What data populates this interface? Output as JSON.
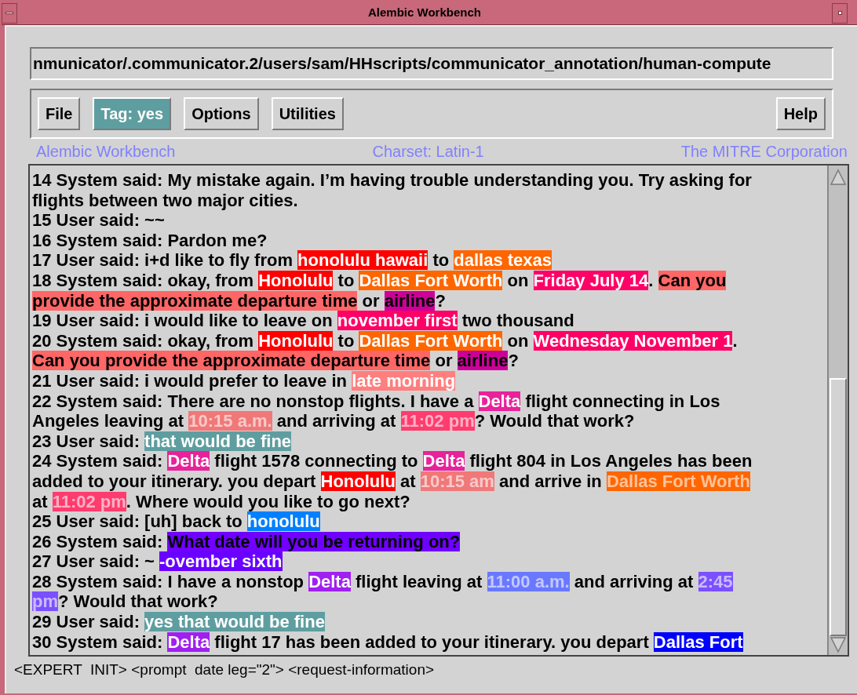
{
  "window": {
    "title": "Alembic Workbench"
  },
  "path_field": {
    "value": "nmunicator/.communicator.2/users/sam/HHscripts/communicator_annotation/human-compute"
  },
  "menu_buttons": [
    {
      "label": "File",
      "selected": false
    },
    {
      "label": "Tag: yes",
      "selected": true
    },
    {
      "label": "Options",
      "selected": false
    },
    {
      "label": "Utilities",
      "selected": false
    }
  ],
  "help_button": {
    "label": "Help"
  },
  "info_bar": {
    "left": "Alembic Workbench",
    "center": "Charset: Latin-1",
    "right": "The MITRE Corporation"
  },
  "transcript": [
    {
      "segments": [
        {
          "kind": "plain",
          "text": "14 System said: My mistake again. I’m having trouble understanding you. Try asking for"
        }
      ]
    },
    {
      "segments": [
        {
          "kind": "plain",
          "text": "flights between two major cities."
        }
      ]
    },
    {
      "segments": [
        {
          "kind": "plain",
          "text": "15 User said: ~~"
        }
      ]
    },
    {
      "segments": [
        {
          "kind": "plain",
          "text": "16 System said: Pardon me?"
        }
      ]
    },
    {
      "segments": [
        {
          "kind": "plain",
          "text": "17 User said: i+d like to fly from "
        },
        {
          "kind": "tag",
          "text": "honolulu hawaii",
          "color": "#ff0000"
        },
        {
          "kind": "plain",
          "text": " to "
        },
        {
          "kind": "tag",
          "text": "dallas texas",
          "color": "#ff6600"
        }
      ]
    },
    {
      "segments": [
        {
          "kind": "plain",
          "text": "18 System said: okay, from "
        },
        {
          "kind": "tag",
          "text": "Honolulu",
          "color": "#ff0000"
        },
        {
          "kind": "plain",
          "text": " to "
        },
        {
          "kind": "tag",
          "text": "Dallas Fort Worth",
          "color": "#ff6600"
        },
        {
          "kind": "plain",
          "text": " on "
        },
        {
          "kind": "tag",
          "text": "Friday July 14",
          "color": "#ff0066"
        },
        {
          "kind": "plain",
          "text": ". "
        },
        {
          "kind": "tag_dark",
          "text": "Can you",
          "color": "#ff6666"
        }
      ]
    },
    {
      "segments": [
        {
          "kind": "tag_dark",
          "text": "provide the approximate departure time",
          "color": "#ff6666"
        },
        {
          "kind": "plain",
          "text": " or "
        },
        {
          "kind": "tag_dark",
          "text": "airline",
          "color": "#cc0099"
        },
        {
          "kind": "plain",
          "text": "?"
        }
      ]
    },
    {
      "segments": [
        {
          "kind": "plain",
          "text": "19 User said: i would like to leave on "
        },
        {
          "kind": "tag",
          "text": "november first",
          "color": "#ff0066"
        },
        {
          "kind": "plain",
          "text": " two thousand"
        }
      ]
    },
    {
      "segments": [
        {
          "kind": "plain",
          "text": "20 System said: okay, from "
        },
        {
          "kind": "tag",
          "text": "Honolulu",
          "color": "#ff0000"
        },
        {
          "kind": "plain",
          "text": " to "
        },
        {
          "kind": "tag",
          "text": "Dallas Fort Worth",
          "color": "#ff6600"
        },
        {
          "kind": "plain",
          "text": " on "
        },
        {
          "kind": "tag",
          "text": "Wednesday November 1",
          "color": "#ff0066"
        },
        {
          "kind": "plain",
          "text": "."
        }
      ]
    },
    {
      "segments": [
        {
          "kind": "tag_dark",
          "text": "Can you provide the approximate departure time",
          "color": "#ff6666"
        },
        {
          "kind": "plain",
          "text": " or "
        },
        {
          "kind": "tag_dark",
          "text": "airline",
          "color": "#cc0099"
        },
        {
          "kind": "plain",
          "text": "?"
        }
      ]
    },
    {
      "segments": [
        {
          "kind": "plain",
          "text": "21 User said: i would prefer to leave in "
        },
        {
          "kind": "tag",
          "text": "late morning",
          "color": "#ff7f7f"
        }
      ]
    },
    {
      "segments": [
        {
          "kind": "plain",
          "text": "22 System said: There are no nonstop flights. I have a "
        },
        {
          "kind": "tag",
          "text": "Delta",
          "color": "#e8229a"
        },
        {
          "kind": "plain",
          "text": " flight connecting in Los"
        }
      ]
    },
    {
      "segments": [
        {
          "kind": "plain",
          "text": "Angeles leaving at "
        },
        {
          "kind": "tag_faint",
          "text": "10:15 a.m.",
          "color": "#f07878"
        },
        {
          "kind": "plain",
          "text": " and arriving at "
        },
        {
          "kind": "tag_faint",
          "text": "11:02 pm",
          "color": "#ff3c6e"
        },
        {
          "kind": "plain",
          "text": "? Would that work?"
        }
      ]
    },
    {
      "segments": [
        {
          "kind": "plain",
          "text": "23 User said: "
        },
        {
          "kind": "tag",
          "text": "that would be fine",
          "color": "#5f9ea0"
        }
      ]
    },
    {
      "segments": [
        {
          "kind": "plain",
          "text": "24 System said: "
        },
        {
          "kind": "tag",
          "text": "Delta",
          "color": "#e8229a"
        },
        {
          "kind": "plain",
          "text": " flight 1578 connecting to "
        },
        {
          "kind": "tag",
          "text": "Delta",
          "color": "#e8229a"
        },
        {
          "kind": "plain",
          "text": " flight 804 in Los Angeles has been"
        }
      ]
    },
    {
      "segments": [
        {
          "kind": "plain",
          "text": "added to your itinerary. you depart "
        },
        {
          "kind": "tag",
          "text": "Honolulu",
          "color": "#ff0000"
        },
        {
          "kind": "plain",
          "text": " at "
        },
        {
          "kind": "tag_faint",
          "text": "10:15 am",
          "color": "#f07878"
        },
        {
          "kind": "plain",
          "text": " and arrive in "
        },
        {
          "kind": "tag_faint",
          "text": "Dallas Fort Worth",
          "color": "#ff6600"
        }
      ]
    },
    {
      "segments": [
        {
          "kind": "plain",
          "text": "at "
        },
        {
          "kind": "tag_faint",
          "text": "11:02 pm",
          "color": "#ff3c6e"
        },
        {
          "kind": "plain",
          "text": ". Where would you like to go next?"
        }
      ]
    },
    {
      "segments": [
        {
          "kind": "plain",
          "text": "25 User said: [uh] back to "
        },
        {
          "kind": "tag",
          "text": "honolulu",
          "color": "#0080ff"
        }
      ]
    },
    {
      "segments": [
        {
          "kind": "plain",
          "text": "26 System said: "
        },
        {
          "kind": "tag_dark",
          "text": "What date will you be returning on?",
          "color": "#7000ff"
        }
      ]
    },
    {
      "segments": [
        {
          "kind": "plain",
          "text": "27 User said: ~ "
        },
        {
          "kind": "tag",
          "text": "-ovember sixth",
          "color": "#6a00ff"
        }
      ]
    },
    {
      "segments": [
        {
          "kind": "plain",
          "text": "28 System said: I have a nonstop "
        },
        {
          "kind": "tag",
          "text": "Delta",
          "color": "#a020f0"
        },
        {
          "kind": "plain",
          "text": " flight leaving at "
        },
        {
          "kind": "tag_faint",
          "text": "11:00 a.m.",
          "color": "#6a78ff"
        },
        {
          "kind": "plain",
          "text": " and arriving at "
        },
        {
          "kind": "tag_faint",
          "text": "2:45",
          "color": "#7a50ff"
        }
      ]
    },
    {
      "segments": [
        {
          "kind": "tag_faint",
          "text": "pm",
          "color": "#7a50ff"
        },
        {
          "kind": "plain",
          "text": "? Would that work?"
        }
      ]
    },
    {
      "segments": [
        {
          "kind": "plain",
          "text": "29 User said: "
        },
        {
          "kind": "tag",
          "text": "yes that would be fine",
          "color": "#5f9ea0"
        }
      ]
    },
    {
      "segments": [
        {
          "kind": "plain",
          "text": "30 System said: "
        },
        {
          "kind": "tag",
          "text": "Delta",
          "color": "#a020f0"
        },
        {
          "kind": "plain",
          "text": " flight 17 has been added to your itinerary. you depart "
        },
        {
          "kind": "tag",
          "text": "Dallas Fort",
          "color": "#0000ff"
        }
      ]
    }
  ],
  "status_line": "<EXPERT  INIT> <prompt  date leg=\"2\"> <request-information>"
}
